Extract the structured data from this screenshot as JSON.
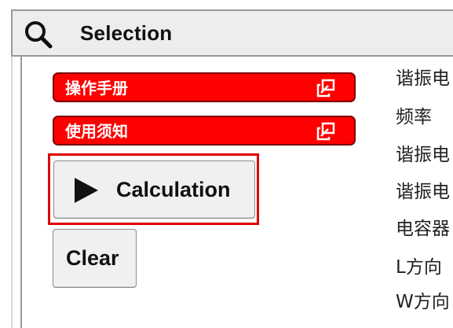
{
  "header": {
    "title": "Selection",
    "icon": "search-icon"
  },
  "links": [
    {
      "label": "操作手册",
      "icon": "external-link-icon",
      "color": "#ff0000"
    },
    {
      "label": "使用须知",
      "icon": "external-link-icon",
      "color": "#ff0000"
    }
  ],
  "actions": {
    "calculation_label": "Calculation",
    "calculation_icon": "play-icon",
    "clear_label": "Clear"
  },
  "property_labels": [
    "谐振电",
    "频率",
    "谐振电",
    "谐振电",
    "电容器",
    "L方向",
    "W方向"
  ],
  "colors": {
    "highlight": "#e00000",
    "header_bg": "#ededed",
    "link_bg": "#ff0000"
  }
}
